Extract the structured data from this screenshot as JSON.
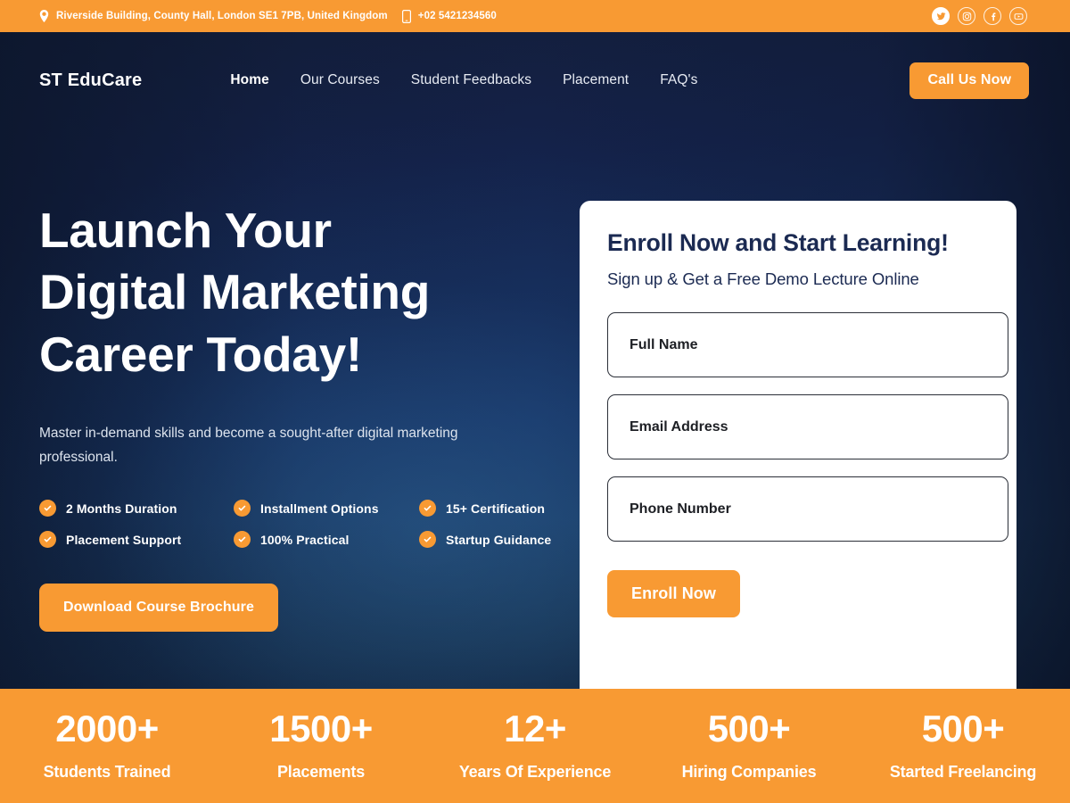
{
  "topbar": {
    "address": "Riverside Building, County Hall, London SE1 7PB, United Kingdom",
    "phone": "+02 5421234560",
    "location_icon": "map-pin-icon",
    "phone_icon": "mobile-phone-icon",
    "socials": [
      {
        "name": "twitter",
        "label": "Twitter"
      },
      {
        "name": "instagram",
        "label": "Instagram"
      },
      {
        "name": "facebook",
        "label": "Facebook"
      },
      {
        "name": "youtube",
        "label": "YouTube"
      }
    ],
    "bg_color": "#f89a33"
  },
  "nav": {
    "logo": "ST EduCare",
    "links": [
      {
        "label": "Home",
        "active": true
      },
      {
        "label": "Our Courses",
        "active": false
      },
      {
        "label": "Student Feedbacks",
        "active": false
      },
      {
        "label": "Placement",
        "active": false
      },
      {
        "label": "FAQ's",
        "active": false
      }
    ],
    "cta_label": "Call Us Now"
  },
  "hero": {
    "headline_lines": [
      "Launch Your",
      "Digital Marketing",
      "Career Today!"
    ],
    "subtext": "Master in-demand skills and become a sought-after digital marketing professional.",
    "features": [
      "2 Months Duration",
      "Installment Options",
      "15+ Certification",
      "Placement Support",
      "100% Practical",
      "Startup Guidance"
    ],
    "brochure_label": "Download Course Brochure",
    "accent_color": "#f89a33",
    "bg_color": "#13203f"
  },
  "form": {
    "title": "Enroll Now and Start Learning!",
    "subtitle": "Sign up & Get a Free Demo Lecture Online",
    "fields": [
      {
        "name": "full-name",
        "placeholder": "Full Name",
        "value": ""
      },
      {
        "name": "email",
        "placeholder": "Email Address",
        "value": ""
      },
      {
        "name": "phone",
        "placeholder": "Phone Number",
        "value": ""
      }
    ],
    "submit_label": "Enroll Now"
  },
  "stats": {
    "bg_color": "#f89a33",
    "items": [
      {
        "value": "2000+",
        "label": "Students Trained"
      },
      {
        "value": "1500+",
        "label": "Placements"
      },
      {
        "value": "12+",
        "label": "Years Of Experience"
      },
      {
        "value": "500+",
        "label": "Hiring Companies"
      },
      {
        "value": "500+",
        "label": "Started Freelancing"
      }
    ]
  }
}
